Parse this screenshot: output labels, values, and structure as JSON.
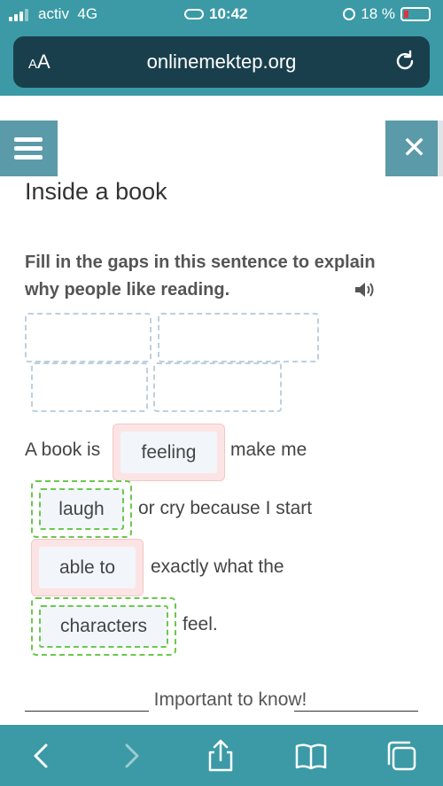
{
  "status_bar": {
    "carrier": "activ",
    "network": "4G",
    "time": "10:42",
    "battery": "18 %",
    "battery_level": 0.18
  },
  "browser": {
    "text_size_label_small": "A",
    "text_size_label_large": "A",
    "url": "onlinemektep.org",
    "reload_icon": "reload-icon"
  },
  "page": {
    "title": "Inside a book",
    "instruction": "Fill in the gaps in this sentence to explain why people like reading.",
    "audio_icon": "speaker-icon"
  },
  "sentence": {
    "part1": "A book is",
    "part2": "make me",
    "part3": "or cry because I start",
    "part4": "exactly what the",
    "part5": "feel."
  },
  "chips": {
    "feeling": "feeling",
    "laugh": "laugh",
    "able_to": "able to",
    "characters": "characters"
  },
  "footer": {
    "important_label": "Important to know!"
  },
  "colors": {
    "bar": "#3b9aa6",
    "url_bar": "#193f4d",
    "button": "#5b9aa9",
    "correct": "#6cc84e",
    "wrong": "#fde4e4"
  }
}
